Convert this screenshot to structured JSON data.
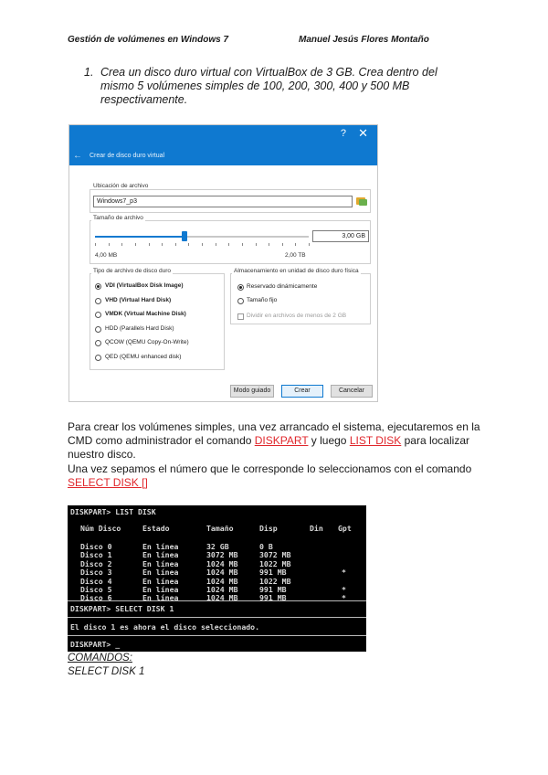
{
  "header": {
    "left": "Gestión de volúmenes en Windows 7",
    "right": "Manuel Jesús Flores Montaño"
  },
  "task": {
    "number": "1.",
    "text": "Crea un disco duro virtual con VirtualBox de 3 GB. Crea dentro del mismo 5 volúmenes simples de 100, 200, 300, 400 y 500 MB respectivamente."
  },
  "dialog": {
    "help": "?",
    "close": "✕",
    "back": "←",
    "heading": "Crear de disco duro virtual",
    "location_label": "Ubicación de archivo",
    "location_value": "Windows7_p3",
    "size_label": "Tamaño de archivo",
    "size_value": "3,00 GB",
    "size_progress": 0.42,
    "size_min": "4,00 MB",
    "size_max": "2,00 TB",
    "type_label": "Tipo de archivo de disco duro",
    "types": [
      {
        "label": "VDI (VirtualBox Disk Image)",
        "selected": true
      },
      {
        "label": "VHD (Virtual Hard Disk)",
        "selected": false
      },
      {
        "label": "VMDK (Virtual Machine Disk)",
        "selected": false
      },
      {
        "label": "HDD (Parallels Hard Disk)",
        "selected": false
      },
      {
        "label": "QCOW (QEMU Copy-On-Write)",
        "selected": false
      },
      {
        "label": "QED (QEMU enhanced disk)",
        "selected": false
      }
    ],
    "storage_label": "Almacenamiento en unidad de disco duro física",
    "storage": [
      {
        "label": "Reservado dinámicamente",
        "selected": true
      },
      {
        "label": "Tamaño fijo",
        "selected": false
      }
    ],
    "split_label": "Dividir en archivos de menos de 2 GB",
    "buttons": {
      "expert": "Modo guiado",
      "create": "Crear",
      "cancel": "Cancelar"
    }
  },
  "para1": {
    "a": "Para crear los volúmenes simples, una vez arrancado el sistema, ejecutaremos en la CMD como administrador el comando ",
    "link1": "DISKPART",
    "b": " y luego ",
    "link2": "LIST DISK",
    "c": " para localizar nuestro disco."
  },
  "para2": {
    "a": "Una vez sepamos el número que le corresponde lo seleccionamos con el comando ",
    "link1": "SELECT DISK []"
  },
  "cmd": {
    "prompt1": "DISKPART> LIST DISK",
    "headers": [
      "Núm Disco",
      "Estado",
      "Tamaño",
      "Disp",
      "Din",
      "Gpt"
    ],
    "rows": [
      [
        "Disco 0",
        "En línea",
        "32 GB",
        "0 B",
        "",
        ""
      ],
      [
        "Disco 1",
        "En línea",
        "3072 MB",
        "3072 MB",
        "",
        ""
      ],
      [
        "Disco 2",
        "En línea",
        "1024 MB",
        "1022 MB",
        "",
        ""
      ],
      [
        "Disco 3",
        "En línea",
        "1024 MB",
        "991 MB",
        "",
        "*"
      ],
      [
        "Disco 4",
        "En línea",
        "1024 MB",
        "1022 MB",
        "",
        ""
      ],
      [
        "Disco 5",
        "En línea",
        "1024 MB",
        "991 MB",
        "",
        "*"
      ],
      [
        "Disco 6",
        "En línea",
        "1024 MB",
        "991 MB",
        "",
        "*"
      ]
    ],
    "prompt2": "DISKPART> SELECT DISK 1",
    "result": "El disco 1 es ahora el disco seleccionado.",
    "prompt3": "DISKPART> _"
  },
  "commands": {
    "title": "COMANDOS:",
    "line1": "SELECT DISK 1"
  }
}
